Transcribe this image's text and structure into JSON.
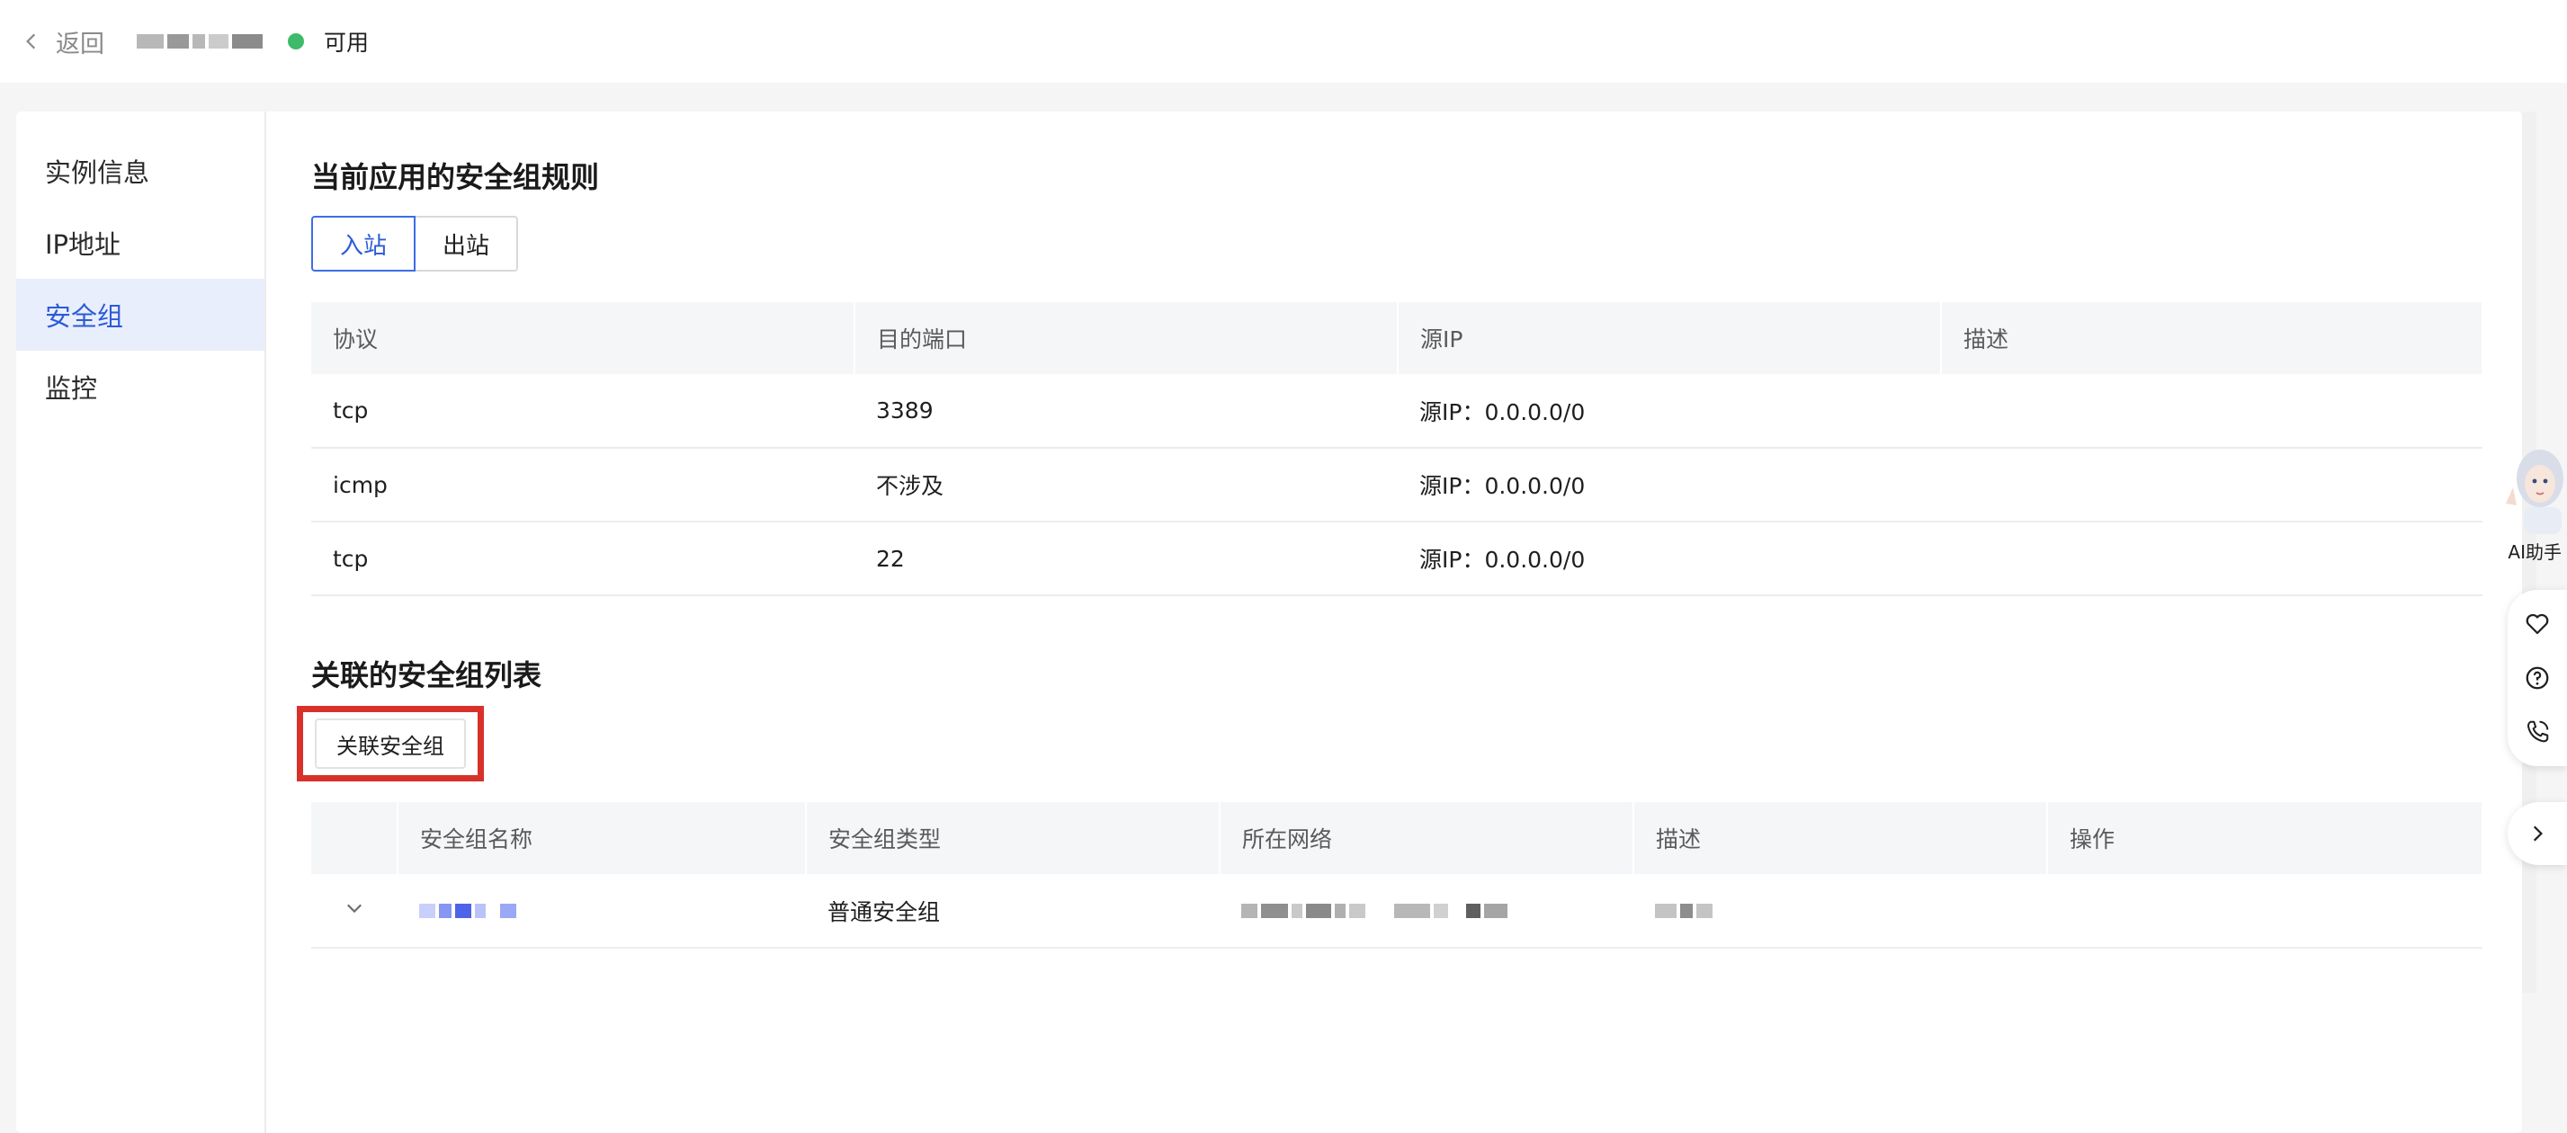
{
  "topbar": {
    "back_label": "返回",
    "status_text": "可用",
    "status_color": "#3dbb6b"
  },
  "sidebar": {
    "items": [
      {
        "label": "实例信息",
        "active": false
      },
      {
        "label": "IP地址",
        "active": false
      },
      {
        "label": "安全组",
        "active": true
      },
      {
        "label": "监控",
        "active": false
      }
    ]
  },
  "rules": {
    "title": "当前应用的安全组规则",
    "tabs": [
      {
        "label": "入站",
        "active": true
      },
      {
        "label": "出站",
        "active": false
      }
    ],
    "columns": [
      "协议",
      "目的端口",
      "源IP",
      "描述"
    ],
    "rows": [
      {
        "protocol": "tcp",
        "port": "3389",
        "source": "源IP：0.0.0.0/0",
        "desc": ""
      },
      {
        "protocol": "icmp",
        "port": "不涉及",
        "source": "源IP：0.0.0.0/0",
        "desc": ""
      },
      {
        "protocol": "tcp",
        "port": "22",
        "source": "源IP：0.0.0.0/0",
        "desc": ""
      }
    ]
  },
  "associated": {
    "title": "关联的安全组列表",
    "associate_button": "关联安全组",
    "columns": [
      "安全组名称",
      "安全组类型",
      "所在网络",
      "描述",
      "操作"
    ],
    "rows": [
      {
        "type": "普通安全组"
      }
    ]
  },
  "assistant": {
    "label": "AI助手"
  },
  "colors": {
    "accent": "#2c5bd8",
    "highlight_border": "#d8312a"
  }
}
